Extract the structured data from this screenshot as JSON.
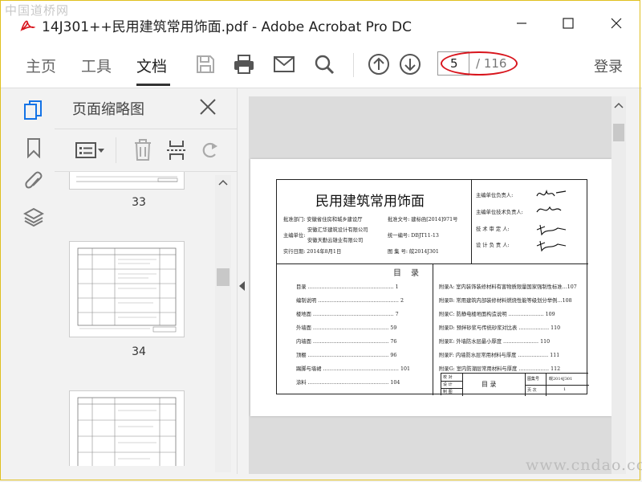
{
  "watermark_top": "中国道桥网",
  "watermark_bottom": "www.cndao.com",
  "window": {
    "title": "14J301++民用建筑常用饰面.pdf - Adobe Acrobat Pro DC"
  },
  "toolbar": {
    "tabs": [
      "主页",
      "工具",
      "文档"
    ],
    "current_page": "5",
    "total_pages": "/ 116",
    "login": "登录"
  },
  "panel": {
    "title": "页面缩略图",
    "thumb_numbers": [
      "33",
      "34"
    ]
  },
  "document": {
    "title": "民用建筑常用饰面",
    "approval_dept": "批准部门: 安徽省住房和城乡建设厅",
    "editor_unit_label": "主编单位:",
    "editor_unit_1": "安徽汇华建筑设计有限公司",
    "editor_unit_2": "安徽天勤云雄业有限公司",
    "effective_date": "实行日期: 2014年8月1日",
    "approval_no": "批准文号: 建标函[2014]971号",
    "unified_no": "统一编号: DBJT11-13",
    "atlas_no": "图 集 号: 皖2014J301",
    "roles": [
      "主编单位负责人:",
      "主编单位技术负责人:",
      "技 术 审 定 人:",
      "设 计 负 责 人:"
    ],
    "toc_heading": "目录",
    "toc_left": [
      {
        "label": "目录",
        "page": "1"
      },
      {
        "label": "编制说明",
        "page": "2"
      },
      {
        "label": "楼地面",
        "page": "7"
      },
      {
        "label": "外墙面",
        "page": "59"
      },
      {
        "label": "内墙面",
        "page": "76"
      },
      {
        "label": "顶棚",
        "page": "96"
      },
      {
        "label": "踢脚与墙裙",
        "page": "101"
      },
      {
        "label": "涂料",
        "page": "104"
      }
    ],
    "toc_right": [
      {
        "label": "附录A: 室内装饰装修材料有害物质限量国家强制性标准",
        "page": "107"
      },
      {
        "label": "附录B: 常用建筑内部装修材料燃烧性能等级划分举例",
        "page": "108"
      },
      {
        "label": "附录C: 防静电楼地面构造说明",
        "page": "109"
      },
      {
        "label": "附录D: 预拌砂浆与传统砂浆对比表",
        "page": "110"
      },
      {
        "label": "附录E: 外墙防水层最小厚度",
        "page": "110"
      },
      {
        "label": "附录F: 内墙防水层常用材料与厚度",
        "page": "111"
      },
      {
        "label": "附录G: 室内防潮层常用材料与厚度",
        "page": "112"
      }
    ],
    "titleblock": {
      "name": "目    录",
      "atlas_label": "图集号",
      "atlas_value": "皖2014J301",
      "page_label": "页  次",
      "page_value": "1",
      "rows": [
        "校 对",
        "设 计",
        "制 图"
      ]
    }
  }
}
